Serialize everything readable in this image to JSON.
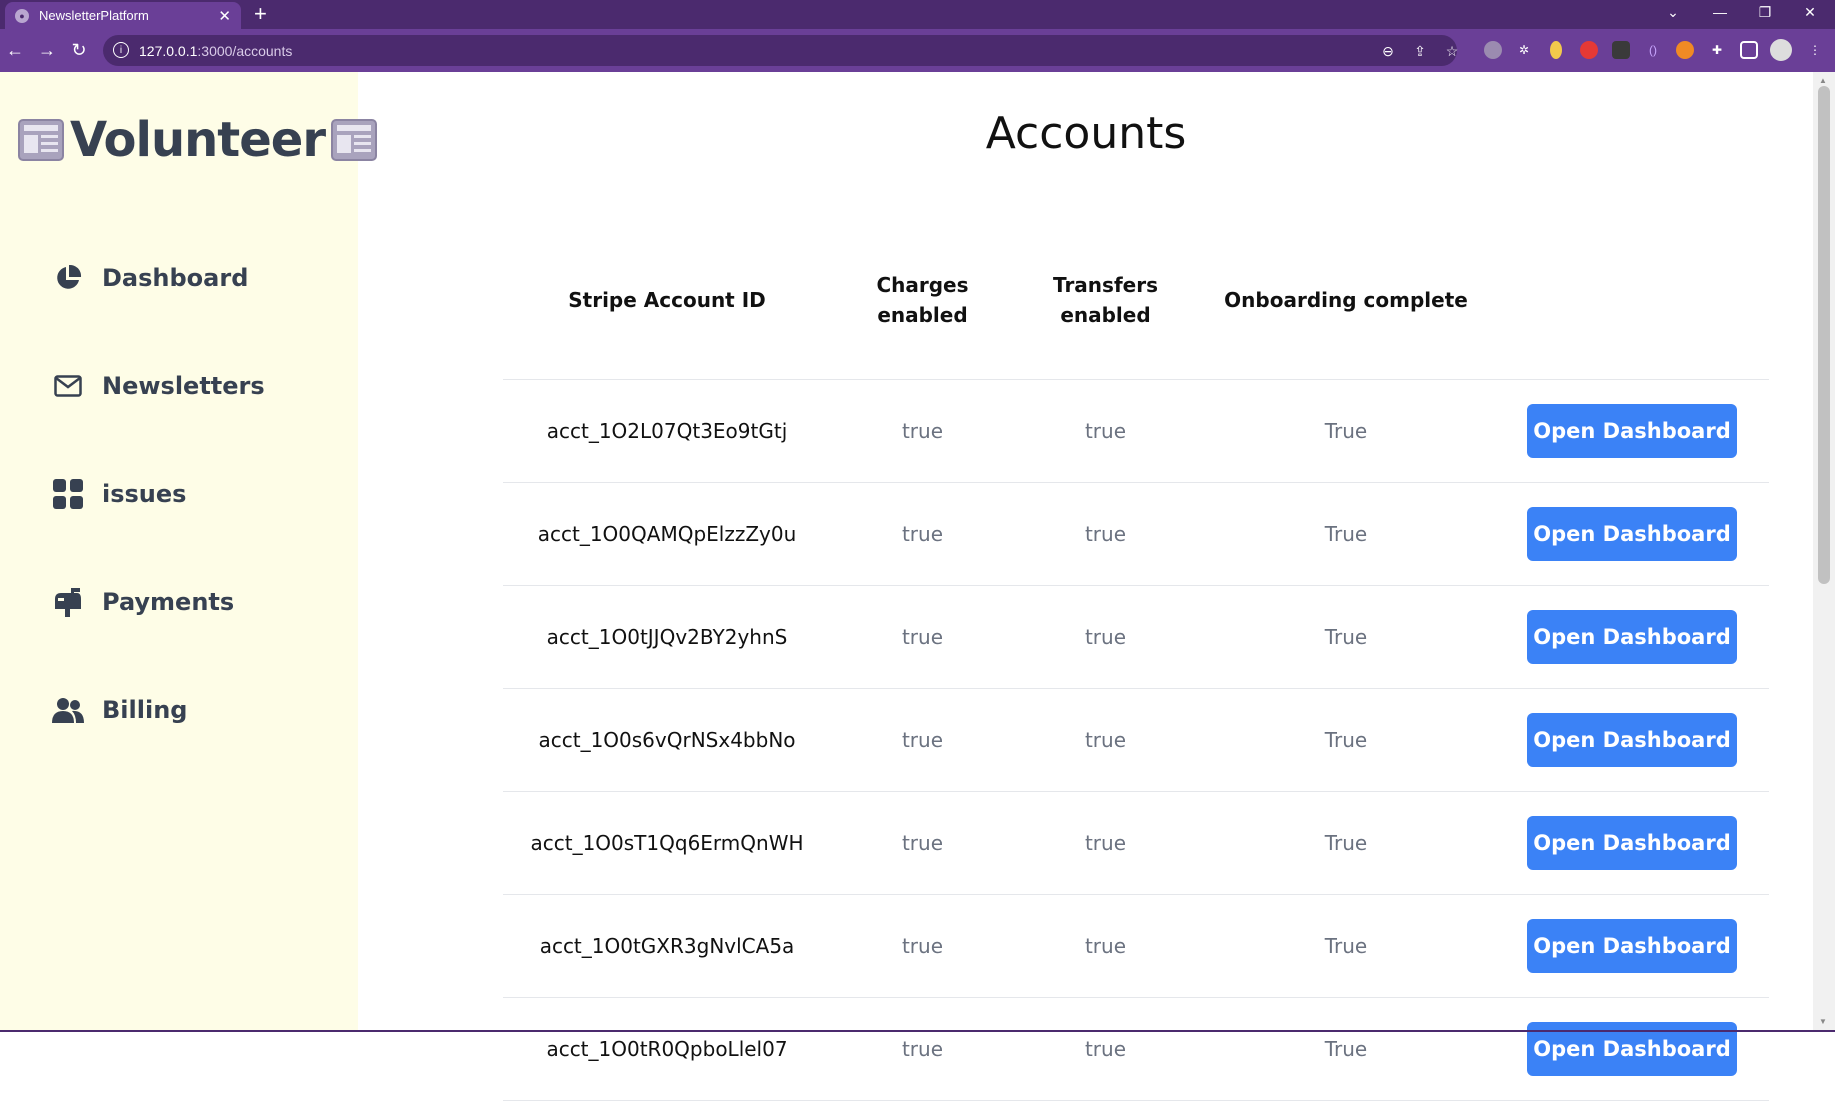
{
  "browser": {
    "tab_title": "NewsletterPlatform",
    "url_host": "127.0.0.1",
    "url_path": ":3000/accounts"
  },
  "sidebar": {
    "brand": "Volunteer",
    "items": [
      {
        "label": "Dashboard",
        "icon": "pie-chart-icon"
      },
      {
        "label": "Newsletters",
        "icon": "envelope-icon"
      },
      {
        "label": "issues",
        "icon": "grid-icon"
      },
      {
        "label": "Payments",
        "icon": "mailbox-icon"
      },
      {
        "label": "Billing",
        "icon": "users-icon"
      }
    ]
  },
  "main": {
    "title": "Accounts",
    "columns": {
      "id": "Stripe Account ID",
      "charges_1": "Charges",
      "charges_2": "enabled",
      "transfers_1": "Transfers",
      "transfers_2": "enabled",
      "onboarding": "Onboarding complete"
    },
    "rows": [
      {
        "id": "acct_1O2L07Qt3Eo9tGtj",
        "charges": "true",
        "transfers": "true",
        "onboarding": "True",
        "action": "Open Dashboard"
      },
      {
        "id": "acct_1O0QAMQpElzzZy0u",
        "charges": "true",
        "transfers": "true",
        "onboarding": "True",
        "action": "Open Dashboard"
      },
      {
        "id": "acct_1O0tJJQv2BY2yhnS",
        "charges": "true",
        "transfers": "true",
        "onboarding": "True",
        "action": "Open Dashboard"
      },
      {
        "id": "acct_1O0s6vQrNSx4bbNo",
        "charges": "true",
        "transfers": "true",
        "onboarding": "True",
        "action": "Open Dashboard"
      },
      {
        "id": "acct_1O0sT1Qq6ErmQnWH",
        "charges": "true",
        "transfers": "true",
        "onboarding": "True",
        "action": "Open Dashboard"
      },
      {
        "id": "acct_1O0tGXR3gNvlCA5a",
        "charges": "true",
        "transfers": "true",
        "onboarding": "True",
        "action": "Open Dashboard"
      },
      {
        "id": "acct_1O0tR0QpboLlel07",
        "charges": "true",
        "transfers": "true",
        "onboarding": "True",
        "action": "Open Dashboard"
      }
    ]
  },
  "colors": {
    "chrome": "#6a3f97",
    "sidebar_bg": "#fefde7",
    "button": "#3b82f6"
  }
}
